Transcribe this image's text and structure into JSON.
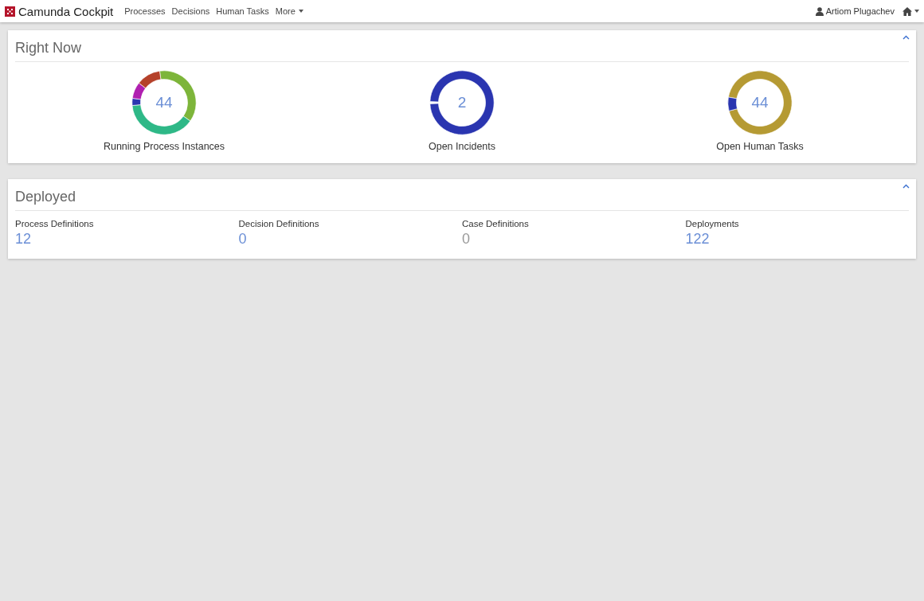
{
  "navbar": {
    "brand": "Camunda Cockpit",
    "links": [
      "Processes",
      "Decisions",
      "Human Tasks"
    ],
    "more": "More",
    "user": "Artiom Plugachev"
  },
  "right_now": {
    "title": "Right Now",
    "donuts": [
      {
        "value": "44",
        "label": "Running Process Instances",
        "kind": "multi"
      },
      {
        "value": "2",
        "label": "Open Incidents",
        "kind": "single"
      },
      {
        "value": "44",
        "label": "Open Human Tasks",
        "kind": "split"
      }
    ]
  },
  "deployed": {
    "title": "Deployed",
    "stats": [
      {
        "label": "Process Definitions",
        "value": "12",
        "disabled": false
      },
      {
        "label": "Decision Definitions",
        "value": "0",
        "disabled": false
      },
      {
        "label": "Case Definitions",
        "value": "0",
        "disabled": true
      },
      {
        "label": "Deployments",
        "value": "122",
        "disabled": false
      }
    ]
  }
}
